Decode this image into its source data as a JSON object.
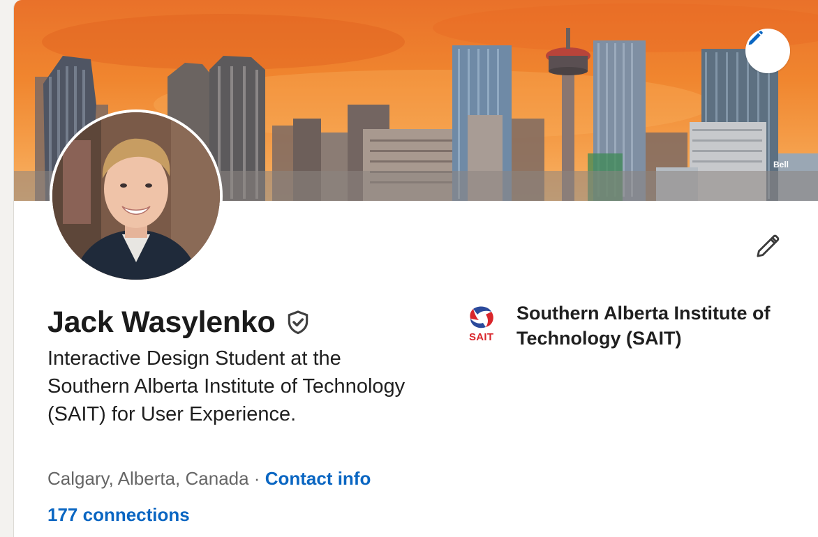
{
  "profile": {
    "name": "Jack Wasylenko",
    "headline": "Interactive Design Student at the Southern Alberta Institute of Technology (SAIT) for User Experience.",
    "location": "Calgary, Alberta, Canada",
    "separator": " · ",
    "contact_label": "Contact info",
    "connections_label": "177 connections"
  },
  "education": {
    "school_name": "Southern Alberta Institute of Technology (SAIT)",
    "logo_text": "SAIT"
  },
  "banner": {
    "watermark": "Bell"
  },
  "icons": {
    "banner_edit": "pencil-icon",
    "intro_edit": "pencil-icon",
    "verified": "verified-shield-icon"
  },
  "colors": {
    "link": "#0a66c2",
    "sait_red": "#d9262b",
    "sait_blue": "#2b4a9b",
    "banner_sky": "#f0862f"
  }
}
